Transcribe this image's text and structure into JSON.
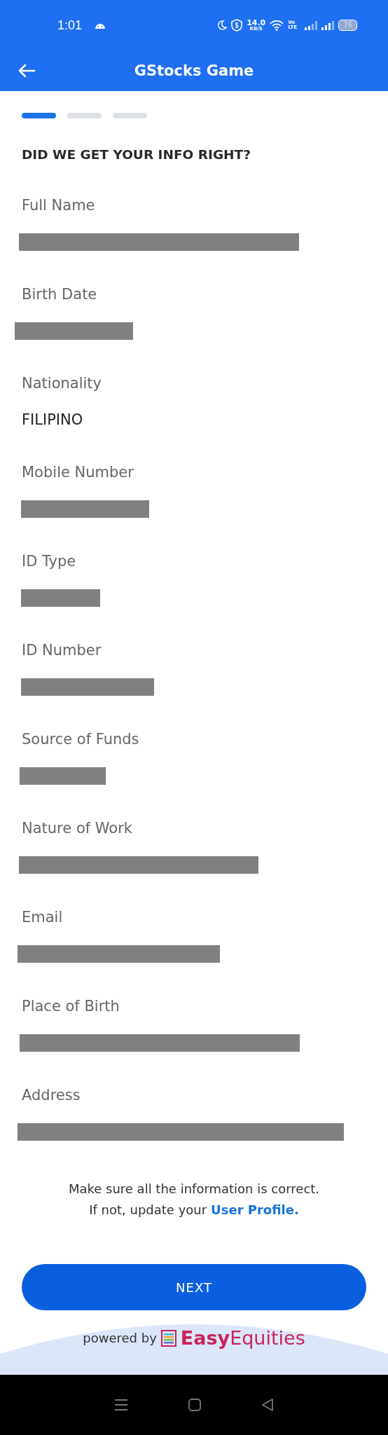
{
  "status_bar": {
    "time": "1:01",
    "net_speed": "14.0",
    "net_unit": "KB/S",
    "volte": "Vo LTE",
    "battery": "76"
  },
  "app_bar": {
    "title": "GStocks Game"
  },
  "steps": [
    {
      "selected": true
    },
    {
      "selected": false
    },
    {
      "selected": false
    }
  ],
  "heading": "DID WE GET YOUR INFO RIGHT?",
  "fields": [
    {
      "label": "Full Name",
      "redacted": true
    },
    {
      "label": "Birth Date",
      "redacted": true
    },
    {
      "label": "Nationality",
      "value": "FILIPINO"
    },
    {
      "label": "Mobile Number",
      "redacted": true
    },
    {
      "label": "ID Type",
      "redacted": true
    },
    {
      "label": "ID Number",
      "redacted": true
    },
    {
      "label": "Source of Funds",
      "redacted": true
    },
    {
      "label": "Nature of Work",
      "redacted": true
    },
    {
      "label": "Email",
      "redacted": true
    },
    {
      "label": "Place of Birth",
      "redacted": true
    },
    {
      "label": "Address",
      "redacted": true
    }
  ],
  "note": {
    "line_1": "Make sure all the information is correct.",
    "line_2": "If not, update your",
    "link": "User Profile."
  },
  "next_button": "NEXT",
  "footer": {
    "powered_by": "powered by",
    "brand_bold": "Easy",
    "brand_light": "Equities"
  }
}
